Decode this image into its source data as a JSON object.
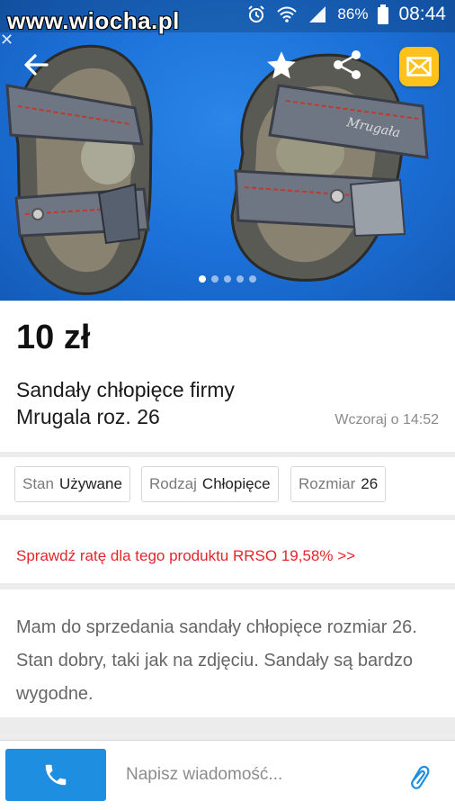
{
  "status_bar": {
    "watermark": "www.wiocha.pl",
    "battery": "86%",
    "time": "08:44",
    "icons": [
      "alarm-icon",
      "wifi-icon",
      "signal-icon",
      "battery-icon"
    ]
  },
  "toolbar": {
    "icons": [
      "back-arrow-icon",
      "star-icon",
      "share-icon",
      "mail-icon"
    ],
    "accent": "#ffc21a"
  },
  "gallery": {
    "image_count": 5,
    "active_index": 0,
    "shoe_label": "Mrugała",
    "background": "#1b6fd6"
  },
  "listing": {
    "price": "10 zł",
    "title": "Sandały chłopięce firmy Mrugala roz. 26",
    "date": "Wczoraj o 14:52"
  },
  "params": [
    {
      "key": "Stan",
      "value": "Używane"
    },
    {
      "key": "Rodzaj",
      "value": "Chłopięce"
    },
    {
      "key": "Rozmiar",
      "value": "26"
    }
  ],
  "promo": {
    "text": "Sprawdź ratę dla tego produktu RRSO 19,58% >>",
    "color": "#e3262b"
  },
  "description": {
    "text": "Mam do sprzedania sandały chłopięce rozmiar 26. Stan dobry, taki jak na zdjęciu. Sandały są bardzo wygodne."
  },
  "bottom_bar": {
    "message_placeholder": "Napisz wiadomość...",
    "call_color": "#1d8ee0",
    "icons": [
      "phone-icon",
      "paperclip-icon"
    ]
  }
}
